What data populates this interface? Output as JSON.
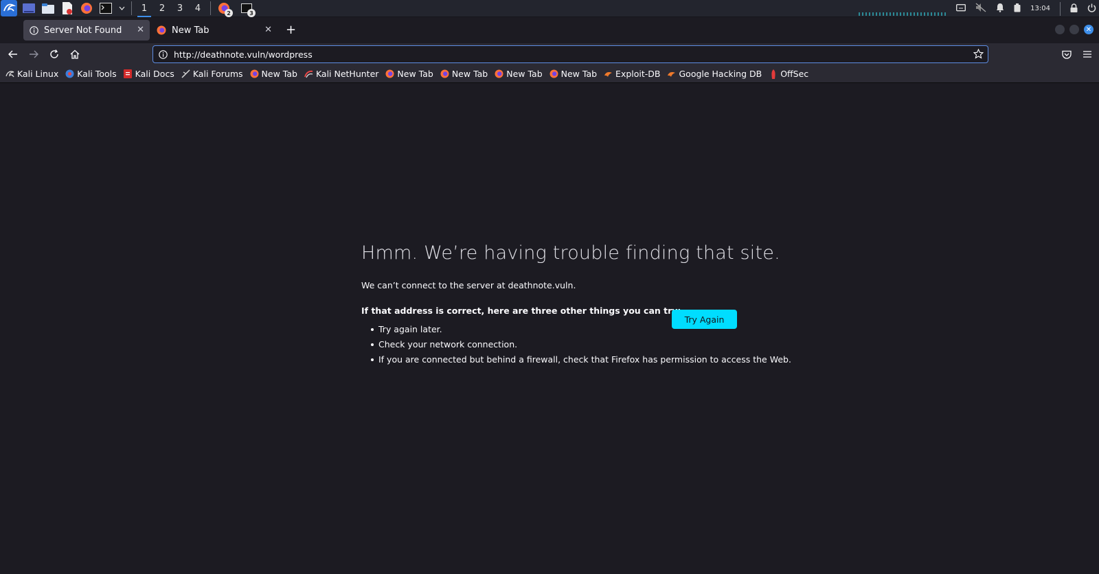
{
  "panel": {
    "workspaces": [
      "1",
      "2",
      "3",
      "4"
    ],
    "active_workspace": "1",
    "task_badges": [
      "2",
      "3"
    ],
    "clock": "13:04"
  },
  "tabs": [
    {
      "title": "Server Not Found",
      "icon": "info-icon",
      "selected": true
    },
    {
      "title": "New Tab",
      "icon": "firefox-icon",
      "selected": false
    }
  ],
  "nav": {
    "url": "http://deathnote.vuln/wordpress"
  },
  "bookmarks": [
    {
      "label": "Kali Linux",
      "icon": "kali-dragon-icon"
    },
    {
      "label": "Kali Tools",
      "icon": "kali-tools-icon"
    },
    {
      "label": "Kali Docs",
      "icon": "kali-docs-icon"
    },
    {
      "label": "Kali Forums",
      "icon": "kali-forums-icon"
    },
    {
      "label": "New Tab",
      "icon": "firefox-icon"
    },
    {
      "label": "Kali NetHunter",
      "icon": "nethunter-icon"
    },
    {
      "label": "New Tab",
      "icon": "firefox-icon"
    },
    {
      "label": "New Tab",
      "icon": "firefox-icon"
    },
    {
      "label": "New Tab",
      "icon": "firefox-icon"
    },
    {
      "label": "New Tab",
      "icon": "firefox-icon"
    },
    {
      "label": "Exploit-DB",
      "icon": "exploit-db-icon"
    },
    {
      "label": "Google Hacking DB",
      "icon": "ghdb-icon"
    },
    {
      "label": "OffSec",
      "icon": "offsec-icon"
    }
  ],
  "error": {
    "title": "Hmm. We’re having trouble finding that site.",
    "description": "We can’t connect to the server at deathnote.vuln.",
    "subtitle": "If that address is correct, here are three other things you can try:",
    "suggestions": [
      "Try again later.",
      "Check your network connection.",
      "If you are connected but behind a firewall, check that Firefox has permission to access the Web."
    ],
    "button_label": "Try Again"
  },
  "colors": {
    "background": "#1c1b22",
    "toolbar": "#2b2a33",
    "accent_button": "#00ddff",
    "url_focus": "#5e8ee4"
  }
}
